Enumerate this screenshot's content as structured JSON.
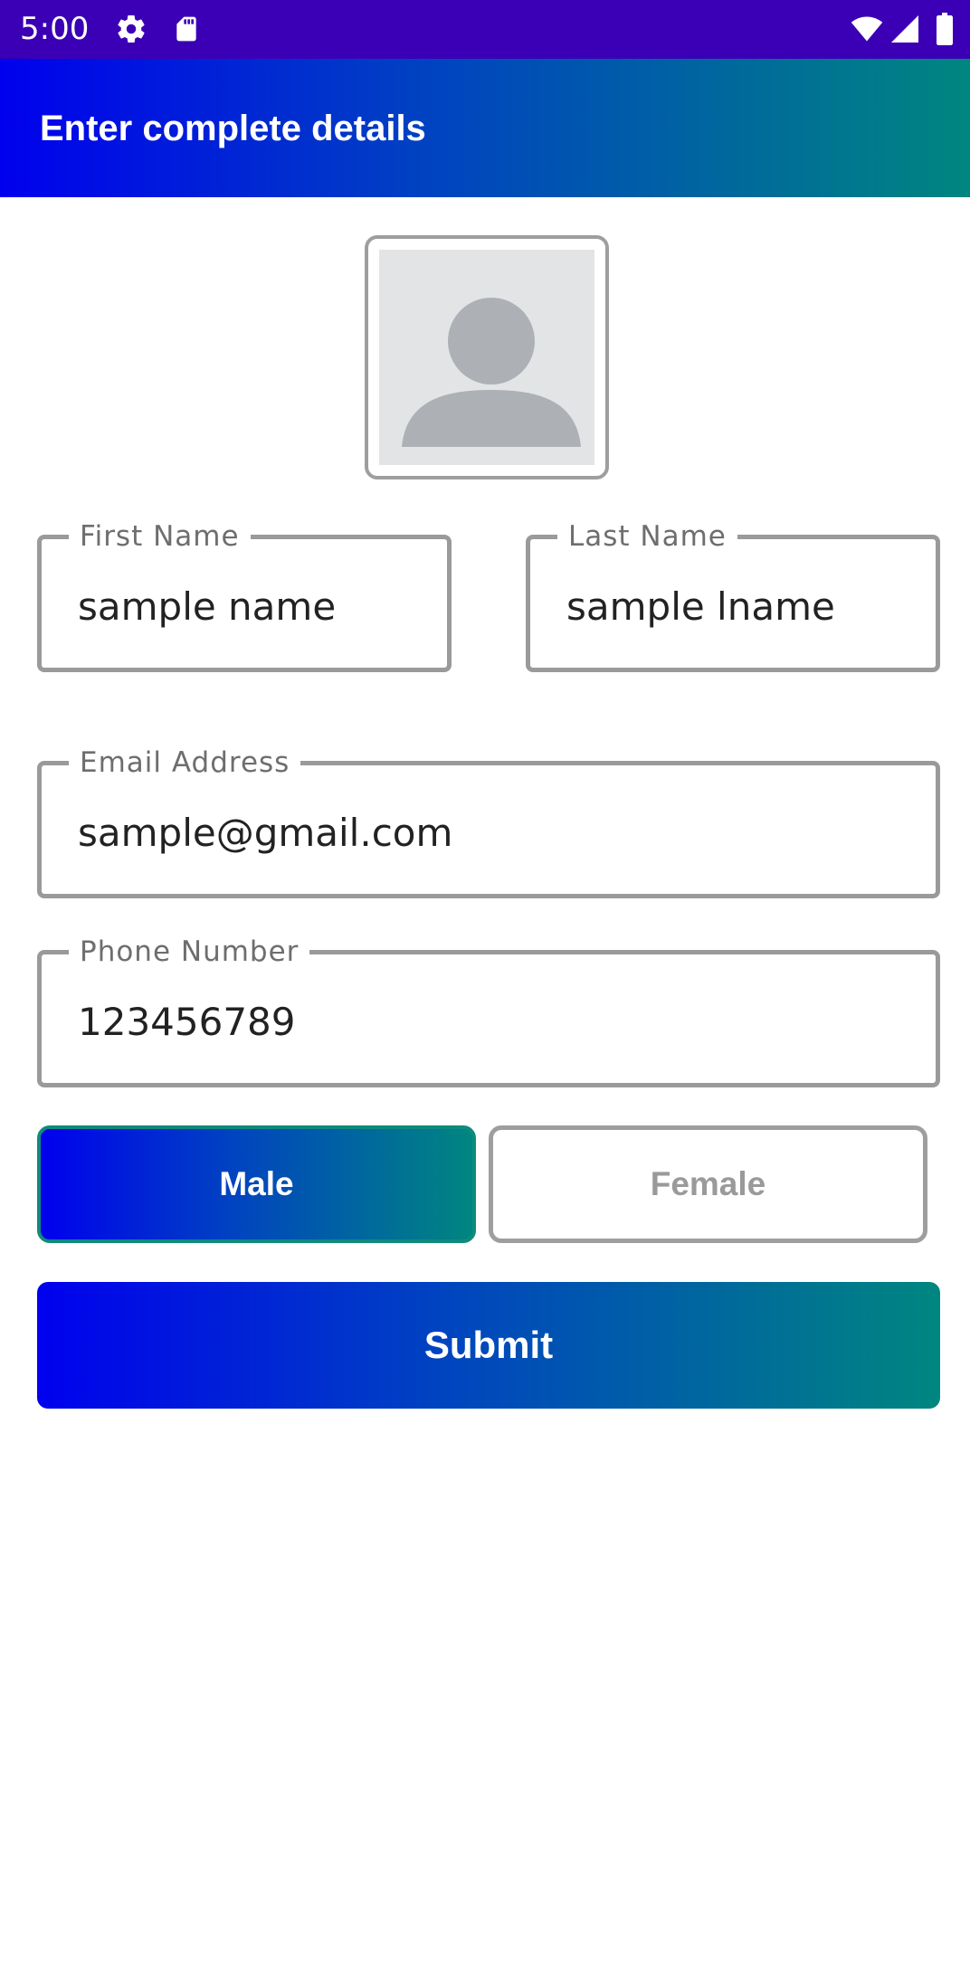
{
  "status_bar": {
    "time": "5:00",
    "icons": [
      "gear-icon",
      "sd-card-icon",
      "wifi-icon",
      "signal-icon",
      "battery-icon"
    ],
    "background": "#3b00b5"
  },
  "app_bar": {
    "title": "Enter complete details",
    "gradient": [
      "#0000ee",
      "#008680"
    ]
  },
  "avatar": {
    "icon": "person-placeholder-icon"
  },
  "form": {
    "first_name": {
      "label": "First Name",
      "value": "sample name"
    },
    "last_name": {
      "label": "Last Name",
      "value": "sample lname"
    },
    "email": {
      "label": "Email Address",
      "value": "sample@gmail.com"
    },
    "phone": {
      "label": "Phone Number",
      "value": "123456789"
    }
  },
  "gender": {
    "options": [
      "Male",
      "Female"
    ],
    "selected": "Male",
    "male_label": "Male",
    "female_label": "Female"
  },
  "submit": {
    "label": "Submit"
  }
}
